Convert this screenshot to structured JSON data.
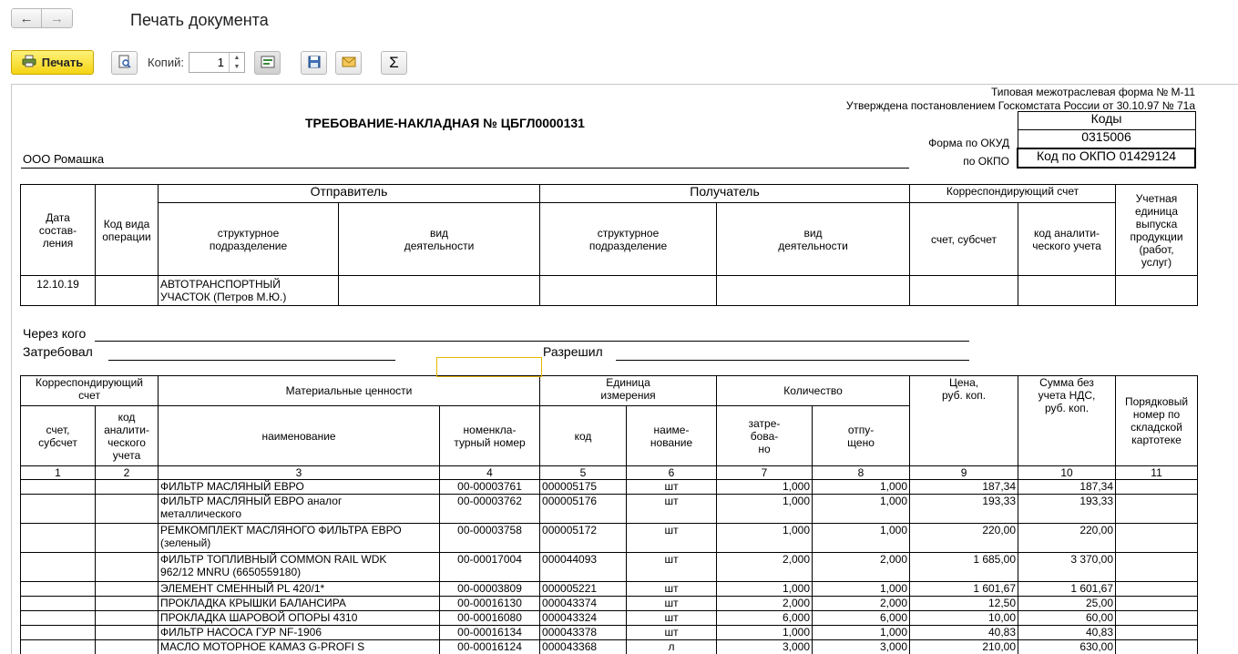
{
  "window": {
    "title": "Печать документа",
    "back_glyph": "←",
    "forward_glyph": "→"
  },
  "toolbar": {
    "print_label": "Печать",
    "copies_label": "Копий:",
    "copies_value": "1",
    "spin_up": "▲",
    "spin_down": "▼",
    "icons": [
      "preview-icon",
      "settings-icon",
      "save-icon",
      "email-icon",
      "sum-icon"
    ],
    "sum_glyph": "Σ"
  },
  "accent_colors": {
    "print_button": "#f4d313",
    "selection": "#e6b800"
  },
  "document": {
    "form_line1": "Типовая межотраслевая форма № М-11",
    "form_line2": "Утверждена постановлением Госкомстата России от 30.10.97 № 71а",
    "heading": "ТРЕБОВАНИЕ-НАКЛАДНАЯ № ЦБГЛ0000131",
    "organization": "ООО Ромашка",
    "codes_header": "Коды",
    "okud_label": "Форма по ОКУД",
    "okud_value": "0315006",
    "okpo_label": "по ОКПО",
    "okpo_value": "Код по ОКПО 01429124",
    "header_table": {
      "date_col": "Дата\nсостав-\nления",
      "opcode_col": "Код вида\nоперации",
      "sender": "Отправитель",
      "receiver": "Получатель",
      "corr_account": "Корреспондирующий счет",
      "unit_col": "Учетная\nединица\nвыпуска\nпродукции\n(работ,\nуслуг)",
      "struct_unit": "структурное\nподразделение",
      "activity": "вид\nдеятельности",
      "account_sub": "счет, субсчет",
      "analytic_code": "код аналити-\nческого учета",
      "row_date": "12.10.19",
      "row_sender_unit": "АВТОТРАНСПОРТНЫЙ\nУЧАСТОК (Петров М.Ю.)"
    },
    "through_label": "Через кого",
    "requested_label": "Затребовал",
    "permitted_label": "Разрешил",
    "items_table": {
      "h_corr": "Корреспондирующий\nсчет",
      "h_materials": "Материальные ценности",
      "h_unit": "Единица\nизмерения",
      "h_qty": "Количество",
      "h_price": "Цена,\nруб. коп.",
      "h_sum": "Сумма без\nучета НДС,\nруб. коп.",
      "h_order": "Порядковый\nномер по\nскладской\nкартотеке",
      "h_account": "счет,\nсубсчет",
      "h_analytic": "код\nаналити-\nческого\nучета",
      "h_name": "наименование",
      "h_nomen": "номенкла-\nтурный номер",
      "h_code": "код",
      "h_unit_name": "наиме-\nнование",
      "h_requested": "затре-\nбова-\nно",
      "h_released": "отпу-\nщено",
      "col_numbers": [
        "1",
        "2",
        "3",
        "4",
        "5",
        "6",
        "7",
        "8",
        "9",
        "10",
        "11"
      ],
      "rows": [
        {
          "name": "ФИЛЬТР МАСЛЯНЫЙ ЕВРО",
          "nomen": "00-00003761",
          "code": "000005175",
          "unit": "шт",
          "req": "1,000",
          "rel": "1,000",
          "price": "187,34",
          "sum": "187,34"
        },
        {
          "name": "ФИЛЬТР МАСЛЯНЫЙ ЕВРО аналог\nметаллического",
          "nomen": "00-00003762",
          "code": "000005176",
          "unit": "шт",
          "req": "1,000",
          "rel": "1,000",
          "price": "193,33",
          "sum": "193,33"
        },
        {
          "name": "РЕМКОМПЛЕКТ МАСЛЯНОГО ФИЛЬТРА ЕВРО\n(зеленый)",
          "nomen": "00-00003758",
          "code": "000005172",
          "unit": "шт",
          "req": "1,000",
          "rel": "1,000",
          "price": "220,00",
          "sum": "220,00"
        },
        {
          "name": "ФИЛЬТР ТОПЛИВНЫЙ COMMON RAIL WDK\n962/12 MNRU (6650559180)",
          "nomen": "00-00017004",
          "code": "000044093",
          "unit": "шт",
          "req": "2,000",
          "rel": "2,000",
          "price": "1 685,00",
          "sum": "3 370,00"
        },
        {
          "name": "ЭЛЕМЕНТ СМЕННЫЙ PL 420/1*",
          "nomen": "00-00003809",
          "code": "000005221",
          "unit": "шт",
          "req": "1,000",
          "rel": "1,000",
          "price": "1 601,67",
          "sum": "1 601,67"
        },
        {
          "name": "ПРОКЛАДКА  КРЫШКИ БАЛАНСИРА",
          "nomen": "00-00016130",
          "code": "000043374",
          "unit": "шт",
          "req": "2,000",
          "rel": "2,000",
          "price": "12,50",
          "sum": "25,00"
        },
        {
          "name": "ПРОКЛАДКА ШАРОВОЙ ОПОРЫ 4310",
          "nomen": "00-00016080",
          "code": "000043324",
          "unit": "шт",
          "req": "6,000",
          "rel": "6,000",
          "price": "10,00",
          "sum": "60,00"
        },
        {
          "name": "ФИЛЬТР НАСОСА ГУР NF-1906",
          "nomen": "00-00016134",
          "code": "000043378",
          "unit": "шт",
          "req": "1,000",
          "rel": "1,000",
          "price": "40,83",
          "sum": "40,83"
        },
        {
          "name": "МАСЛО МОТОРНОЕ КАМАЗ G-PROFI S",
          "nomen": "00-00016124",
          "code": "000043368",
          "unit": "л",
          "req": "3,000",
          "rel": "3,000",
          "price": "210,00",
          "sum": "630,00"
        }
      ]
    }
  }
}
